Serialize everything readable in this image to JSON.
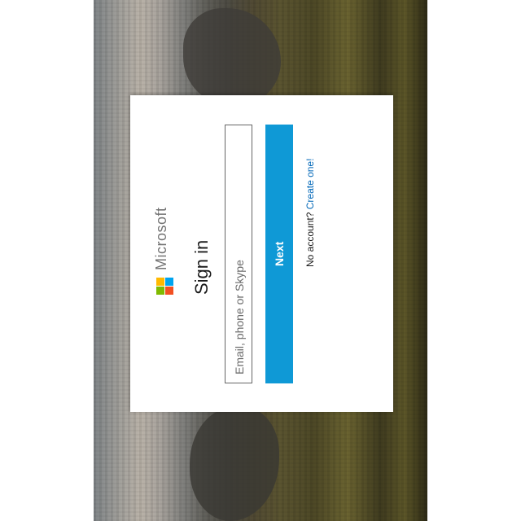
{
  "brand": {
    "name": "Microsoft",
    "logo_colors": [
      "#f25022",
      "#7fba00",
      "#00a4ef",
      "#ffb900"
    ]
  },
  "signin": {
    "title": "Sign in",
    "email_placeholder": "Email, phone or Skype",
    "next_label": "Next",
    "no_account_text": "No account?",
    "create_link": "Create one!"
  },
  "colors": {
    "accent": "#0f99d6",
    "link": "#0067b8"
  }
}
